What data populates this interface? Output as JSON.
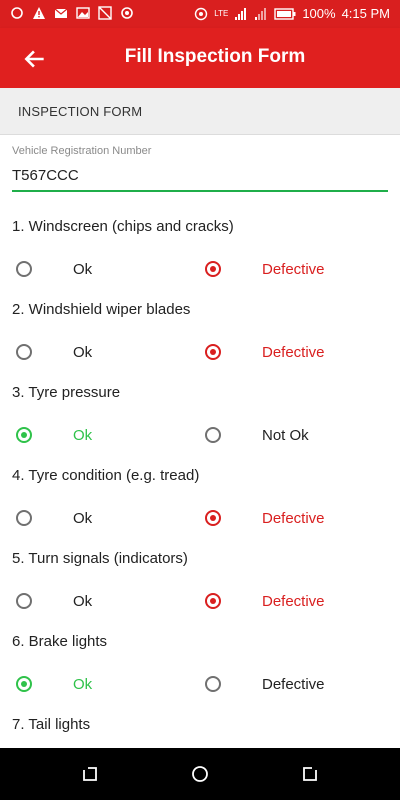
{
  "status_bar": {
    "battery": "100%",
    "time": "4:15 PM",
    "network": "LTE"
  },
  "app_bar": {
    "title": "Fill Inspection Form"
  },
  "section": {
    "title": "INSPECTION FORM"
  },
  "vehicle_field": {
    "label": "Vehicle Registration Number",
    "value": "T567CCC"
  },
  "questions": [
    {
      "label": "1. Windscreen (chips and cracks)",
      "option_a": "Ok",
      "option_b": "Defective",
      "selected": "option_b"
    },
    {
      "label": "2. Windshield wiper blades",
      "option_a": "Ok",
      "option_b": "Defective",
      "selected": "option_b"
    },
    {
      "label": "3. Tyre pressure",
      "option_a": "Ok",
      "option_b": "Not Ok",
      "selected": "option_a"
    },
    {
      "label": "4. Tyre condition (e.g. tread)",
      "option_a": "Ok",
      "option_b": "Defective",
      "selected": "option_b"
    },
    {
      "label": "5. Turn signals (indicators)",
      "option_a": "Ok",
      "option_b": "Defective",
      "selected": "option_b"
    },
    {
      "label": "6. Brake lights",
      "option_a": "Ok",
      "option_b": "Defective",
      "selected": "option_a"
    },
    {
      "label": "7. Tail lights"
    }
  ],
  "colors": {
    "primary": "#e0201f",
    "selected_defective": "#d91f1f",
    "selected_ok": "#2fc24a",
    "field_underline": "#1fae4a"
  }
}
